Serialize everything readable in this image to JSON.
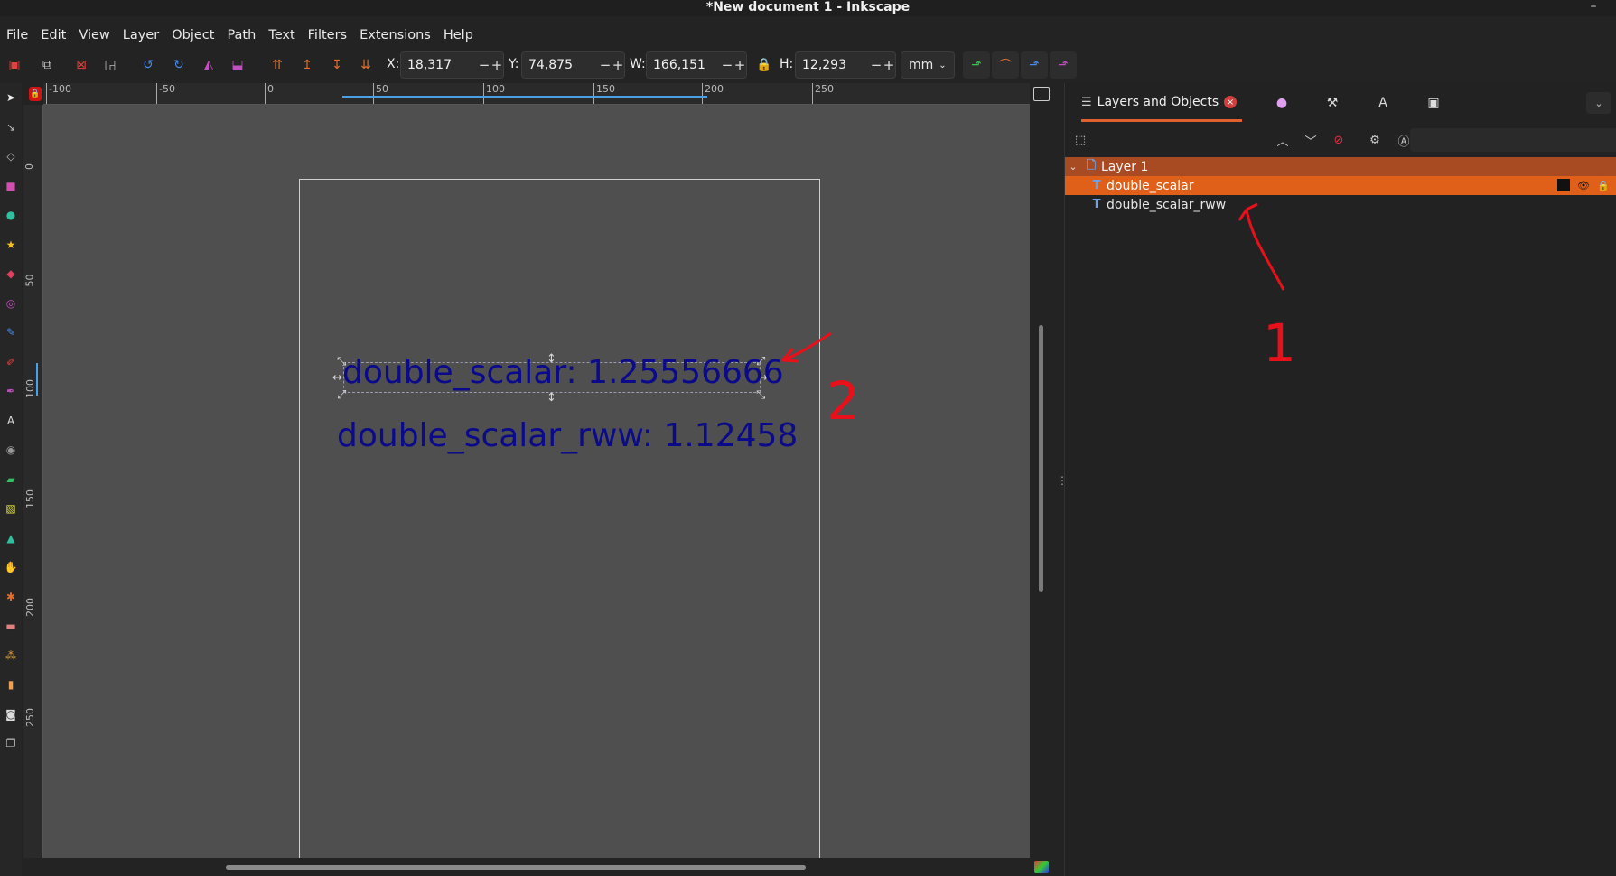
{
  "window": {
    "title": "*New document 1 - Inkscape",
    "minimize_glyph": "–"
  },
  "menu": [
    "File",
    "Edit",
    "View",
    "Layer",
    "Object",
    "Path",
    "Text",
    "Filters",
    "Extensions",
    "Help"
  ],
  "toolbar": {
    "x_label": "X:",
    "x_value": "18,317",
    "y_label": "Y:",
    "y_value": "74,875",
    "w_label": "W:",
    "w_value": "166,151",
    "h_label": "H:",
    "h_value": "12,293",
    "unit": "mm",
    "minus": "−",
    "plus": "+"
  },
  "ruler": {
    "top_labels": [
      "-100",
      "-50",
      "0",
      "50",
      "100",
      "150",
      "200",
      "250"
    ],
    "left_labels": [
      "0",
      "50",
      "100",
      "150",
      "200",
      "250"
    ]
  },
  "canvas": {
    "text1": "double_scalar: 1.25556666",
    "text2": "double_scalar_rww: 1.12458"
  },
  "dock": {
    "tab_label": "Layers and Objects",
    "tab_close": "×"
  },
  "layers": {
    "layer_name": "Layer 1",
    "objects": [
      "double_scalar",
      "double_scalar_rww"
    ],
    "text_node_glyph": "T"
  },
  "annotations": {
    "one": "1",
    "two": "2"
  },
  "colors": {
    "accent": "#e0601a",
    "layer_row": "#a84a22",
    "canvas_text": "#0a0a8a",
    "annotation": "#e8101a"
  }
}
